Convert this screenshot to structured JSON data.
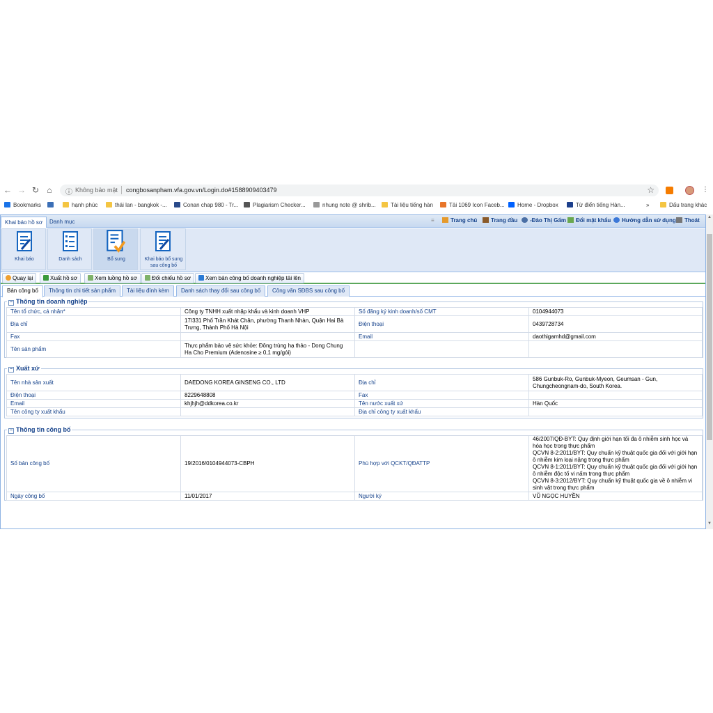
{
  "browser": {
    "insecure_label": "Không bảo mật",
    "url": "congbosanpham.vfa.gov.vn/Login.do#1588909403479",
    "bookmarks": [
      {
        "label": "Bookmarks",
        "color": "#1a73e8"
      },
      {
        "label": "",
        "color": "#3b6fb6"
      },
      {
        "label": "hạnh phúc",
        "color": "#f4c542"
      },
      {
        "label": "thái lan - bangkok -...",
        "color": "#f4c542"
      },
      {
        "label": "Conan chap 980 - Tr...",
        "color": "#2a4a8a"
      },
      {
        "label": "Plagiarism Checker...",
        "color": "#555555"
      },
      {
        "label": "nhung note @ shrib...",
        "color": "#999999"
      },
      {
        "label": "Tài liệu tiếng hàn",
        "color": "#f4c542"
      },
      {
        "label": "Tải 1069 Icon Faceb...",
        "color": "#e8752a"
      },
      {
        "label": "Home - Dropbox",
        "color": "#0061fe"
      },
      {
        "label": "Từ điển tiếng Hàn...",
        "color": "#1c3f8c"
      }
    ],
    "more": "»",
    "other_bookmarks": "Dấu trang khác"
  },
  "app": {
    "top_tabs": [
      "Khai báo hồ sơ",
      "Danh mục"
    ],
    "top_links": [
      "Trang chủ",
      "Trang đầu",
      "-Đào Thị Gấm",
      "Đổi mật khẩu",
      "Hướng dẫn sử dụng",
      "Thoát"
    ],
    "ribbon": [
      {
        "label": "Khai báo"
      },
      {
        "label": "Danh sách"
      },
      {
        "label": "Bổ sung"
      },
      {
        "label": "Khai báo bổ sung sau công bố"
      }
    ],
    "toolbar": [
      "Quay lại",
      "Xuất hồ sơ",
      "Xem luồng hồ sơ",
      "Đối chiếu hồ sơ",
      "Xem bản công bố doanh nghiệp tải lên"
    ],
    "sub_tabs": [
      "Bản công bố",
      "Thông tin chi tiết sản phẩm",
      "Tài liệu đính kèm",
      "Danh sách thay đổi sau công bố",
      "Công văn SĐBS sau công bố"
    ]
  },
  "sections": {
    "doanh_nghiep": {
      "title": "Thông tin doanh nghiệp",
      "rows": [
        [
          "Tên tổ chức, cá nhân*",
          "Công ty TNHH xuất nhập khẩu và kinh doanh VHP",
          "Số đăng ký kinh doanh/số CMT",
          "0104944073"
        ],
        [
          "Địa chỉ",
          "17/331 Phố Trần Khát Chân, phường Thanh Nhàn, Quận Hai Bà Trưng, Thành Phố Hà Nội",
          "Điện thoại",
          "0439728734"
        ],
        [
          "Fax",
          "",
          "Email",
          "daothigamhd@gmail.com"
        ],
        [
          "Tên sản phẩm",
          "Thực phẩm bảo vệ sức khỏe: Đông trùng hạ thảo - Dong Chung Ha Cho Premium (Adenosine ≥ 0,1 mg/gói)",
          "",
          ""
        ]
      ]
    },
    "xuat_xu": {
      "title": "Xuất xứ",
      "rows": [
        [
          "Tên nhà sản xuất",
          "DAEDONG KOREA GINSENG CO., LTD",
          "Địa chỉ",
          "586 Gunbuk-Ro, Gunbuk-Myeon, Geumsan - Gun, Chungcheongnam-do, South Korea."
        ],
        [
          "Điện thoại",
          "8229648808",
          "Fax",
          ""
        ],
        [
          "Email",
          "khjhjh@ddkorea.co.kr",
          "Tên nước xuất xứ",
          "Hàn Quốc"
        ],
        [
          "Tên công ty xuất khẩu",
          "",
          "Địa chỉ công ty xuất khẩu",
          ""
        ]
      ]
    },
    "cong_bo": {
      "title": "Thông tin công bố",
      "rows": [
        [
          "Số bản công bố",
          "19/2016/0104944073-CBPH",
          "Phù hợp với QCKT/QĐATTP",
          "46/2007/QĐ-BYT: Quy định giới hạn tối đa ô nhiễm sinh học và hóa học trong thực phẩm\nQCVN 8-2:2011/BYT: Quy chuẩn kỹ thuật quốc gia đối với giới hạn ô nhiễm kim loại nặng trong thực phẩm\nQCVN 8-1:2011/BYT: Quy chuẩn kỹ thuật quốc gia đối với giới hạn ô nhiễm độc tố vi nấm trong thực phẩm\nQCVN 8-3:2012/BYT: Quy chuẩn kỹ thuật quốc gia về ô nhiễm vi sinh vật trong thực phẩm"
        ],
        [
          "Ngày công bố",
          "11/01/2017",
          "Người ký",
          "VŨ NGỌC HUYỀN"
        ]
      ]
    }
  }
}
